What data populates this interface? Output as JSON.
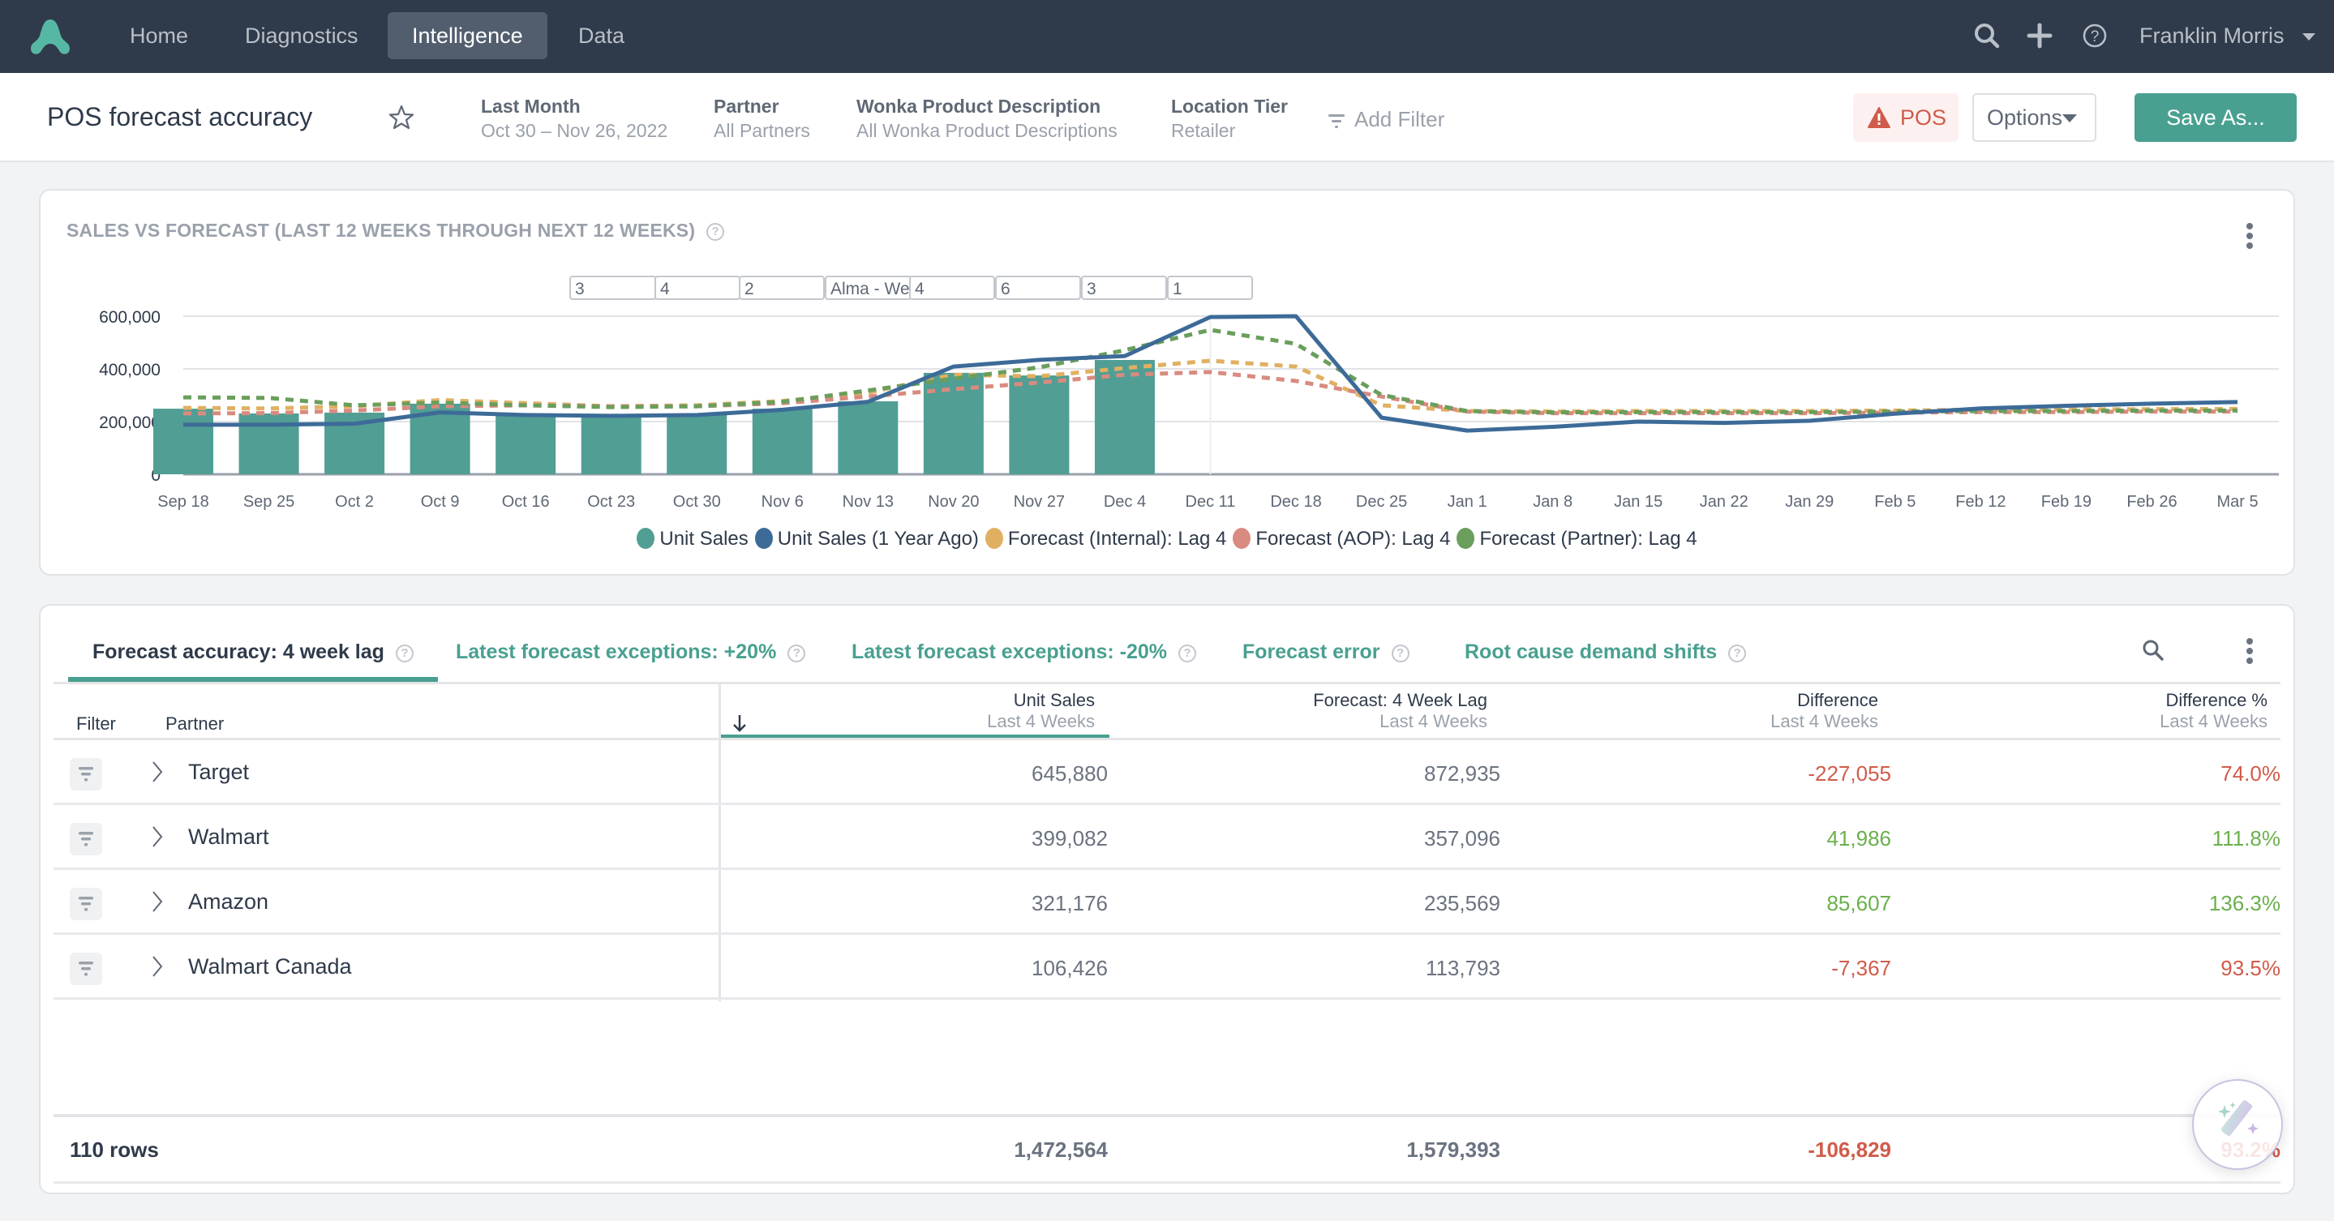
{
  "nav": {
    "items": [
      {
        "label": "Home",
        "active": false
      },
      {
        "label": "Diagnostics",
        "active": false
      },
      {
        "label": "Intelligence",
        "active": true
      },
      {
        "label": "Data",
        "active": false
      }
    ],
    "user_name": "Franklin Morris",
    "icons": [
      "search-icon",
      "plus-icon",
      "help-icon"
    ]
  },
  "header": {
    "title": "POS forecast accuracy",
    "filters": [
      {
        "label": "Last Month",
        "value": "Oct 30 – Nov 26, 2022"
      },
      {
        "label": "Partner",
        "value": "All Partners"
      },
      {
        "label": "Wonka Product Description",
        "value": "All Wonka Product Descriptions"
      },
      {
        "label": "Location Tier",
        "value": "Retailer"
      }
    ],
    "add_filter_label": "Add Filter",
    "pos_badge_label": "POS",
    "options_label": "Options",
    "save_label": "Save As..."
  },
  "colors": {
    "nav_bg": "#2f3a4a",
    "accent": "#49a090",
    "negative": "#d15b4a",
    "positive": "#6ab04c",
    "unit_sales": "#519e94",
    "unit_sales_ly": "#3d6b98",
    "forecast_internal": "#e0b062",
    "forecast_aop": "#d98b80",
    "forecast_partner": "#6a9e5c"
  },
  "chart_card": {
    "title": "SALES VS FORECAST (LAST 12 WEEKS THROUGH NEXT 12 WEEKS)",
    "annotation_boxes": [
      "3",
      "4",
      "2",
      "Alma - Wee",
      "4",
      "6",
      "3",
      "1"
    ]
  },
  "chart_data": {
    "type": "bar",
    "title": "SALES VS FORECAST (LAST 12 WEEKS THROUGH NEXT 12 WEEKS)",
    "xlabel": "",
    "ylabel": "",
    "ylim": [
      0,
      600000
    ],
    "yticks": [
      0,
      200000,
      400000,
      600000
    ],
    "ytick_labels": [
      "0",
      "200,000",
      "400,000",
      "600,000"
    ],
    "grid": true,
    "legend_position": "bottom-center",
    "categories": [
      "Sep 18",
      "Sep 25",
      "Oct 2",
      "Oct 9",
      "Oct 16",
      "Oct 23",
      "Oct 30",
      "Nov 6",
      "Nov 13",
      "Nov 20",
      "Nov 27",
      "Dec 4",
      "Dec 11",
      "Dec 18",
      "Dec 25",
      "Jan 1",
      "Jan 8",
      "Jan 15",
      "Jan 22",
      "Jan 29",
      "Feb 5",
      "Feb 12",
      "Feb 19",
      "Feb 26",
      "Mar 5"
    ],
    "current_week_marker": "Dec 11",
    "series": [
      {
        "name": "Unit Sales",
        "type": "bar",
        "color": "#519e94",
        "values": [
          249000,
          231000,
          234000,
          268000,
          225000,
          218000,
          228000,
          249000,
          277000,
          385000,
          375000,
          434000,
          null,
          null,
          null,
          null,
          null,
          null,
          null,
          null,
          null,
          null,
          null,
          null,
          null
        ]
      },
      {
        "name": "Unit Sales (1 Year Ago)",
        "type": "line",
        "style": "solid",
        "color": "#3d6b98",
        "values": [
          188000,
          188000,
          192000,
          235000,
          225000,
          222000,
          225000,
          245000,
          275000,
          409000,
          434000,
          449000,
          597000,
          600000,
          215000,
          166000,
          180000,
          200000,
          195000,
          203000,
          230000,
          250000,
          260000,
          268000,
          274000
        ]
      },
      {
        "name": "Forecast (Internal): Lag 4",
        "type": "line",
        "style": "dashed",
        "color": "#e0b062",
        "values": [
          252000,
          250000,
          258000,
          282000,
          270000,
          258000,
          262000,
          278000,
          310000,
          378000,
          372000,
          403000,
          431000,
          409000,
          262000,
          240000,
          238000,
          240000,
          240000,
          240000,
          242000,
          245000,
          246000,
          247000,
          248000
        ]
      },
      {
        "name": "Forecast (AOP): Lag 4",
        "type": "line",
        "style": "dashed",
        "color": "#d98b80",
        "values": [
          231000,
          232000,
          242000,
          258000,
          262000,
          258000,
          258000,
          270000,
          295000,
          323000,
          348000,
          378000,
          388000,
          354000,
          295000,
          238000,
          232000,
          232000,
          232000,
          232000,
          234000,
          236000,
          236000,
          238000,
          238000
        ]
      },
      {
        "name": "Forecast (Partner): Lag 4",
        "type": "line",
        "style": "dashed",
        "color": "#6a9e5c",
        "values": [
          292000,
          290000,
          262000,
          272000,
          262000,
          255000,
          258000,
          275000,
          318000,
          363000,
          406000,
          471000,
          548000,
          495000,
          301000,
          240000,
          235000,
          236000,
          236000,
          236000,
          238000,
          240000,
          240000,
          242000,
          242000
        ]
      }
    ]
  },
  "table_card": {
    "tabs": [
      {
        "label": "Forecast accuracy: 4 week lag",
        "active": true
      },
      {
        "label": "Latest forecast exceptions: +20%",
        "active": false
      },
      {
        "label": "Latest forecast exceptions: -20%",
        "active": false
      },
      {
        "label": "Forecast error",
        "active": false
      },
      {
        "label": "Root cause demand shifts",
        "active": false
      }
    ],
    "columns": {
      "filter": "Filter",
      "partner": "Partner",
      "unit_sales": {
        "title": "Unit Sales",
        "sub": "Last 4 Weeks"
      },
      "forecast": {
        "title": "Forecast: 4 Week Lag",
        "sub": "Last 4 Weeks"
      },
      "difference": {
        "title": "Difference",
        "sub": "Last 4 Weeks"
      },
      "difference_pct": {
        "title": "Difference %",
        "sub": "Last 4 Weeks"
      }
    },
    "rows": [
      {
        "partner": "Target",
        "unit_sales": "645,880",
        "forecast": "872,935",
        "difference": "-227,055",
        "difference_pct": "74.0%",
        "sign": "neg"
      },
      {
        "partner": "Walmart",
        "unit_sales": "399,082",
        "forecast": "357,096",
        "difference": "41,986",
        "difference_pct": "111.8%",
        "sign": "pos"
      },
      {
        "partner": "Amazon",
        "unit_sales": "321,176",
        "forecast": "235,569",
        "difference": "85,607",
        "difference_pct": "136.3%",
        "sign": "pos"
      },
      {
        "partner": "Walmart Canada",
        "unit_sales": "106,426",
        "forecast": "113,793",
        "difference": "-7,367",
        "difference_pct": "93.5%",
        "sign": "neg"
      }
    ],
    "footer": {
      "row_count": "110 rows",
      "unit_sales": "1,472,564",
      "forecast": "1,579,393",
      "difference": "-106,829",
      "difference_pct": "93.2%"
    }
  }
}
